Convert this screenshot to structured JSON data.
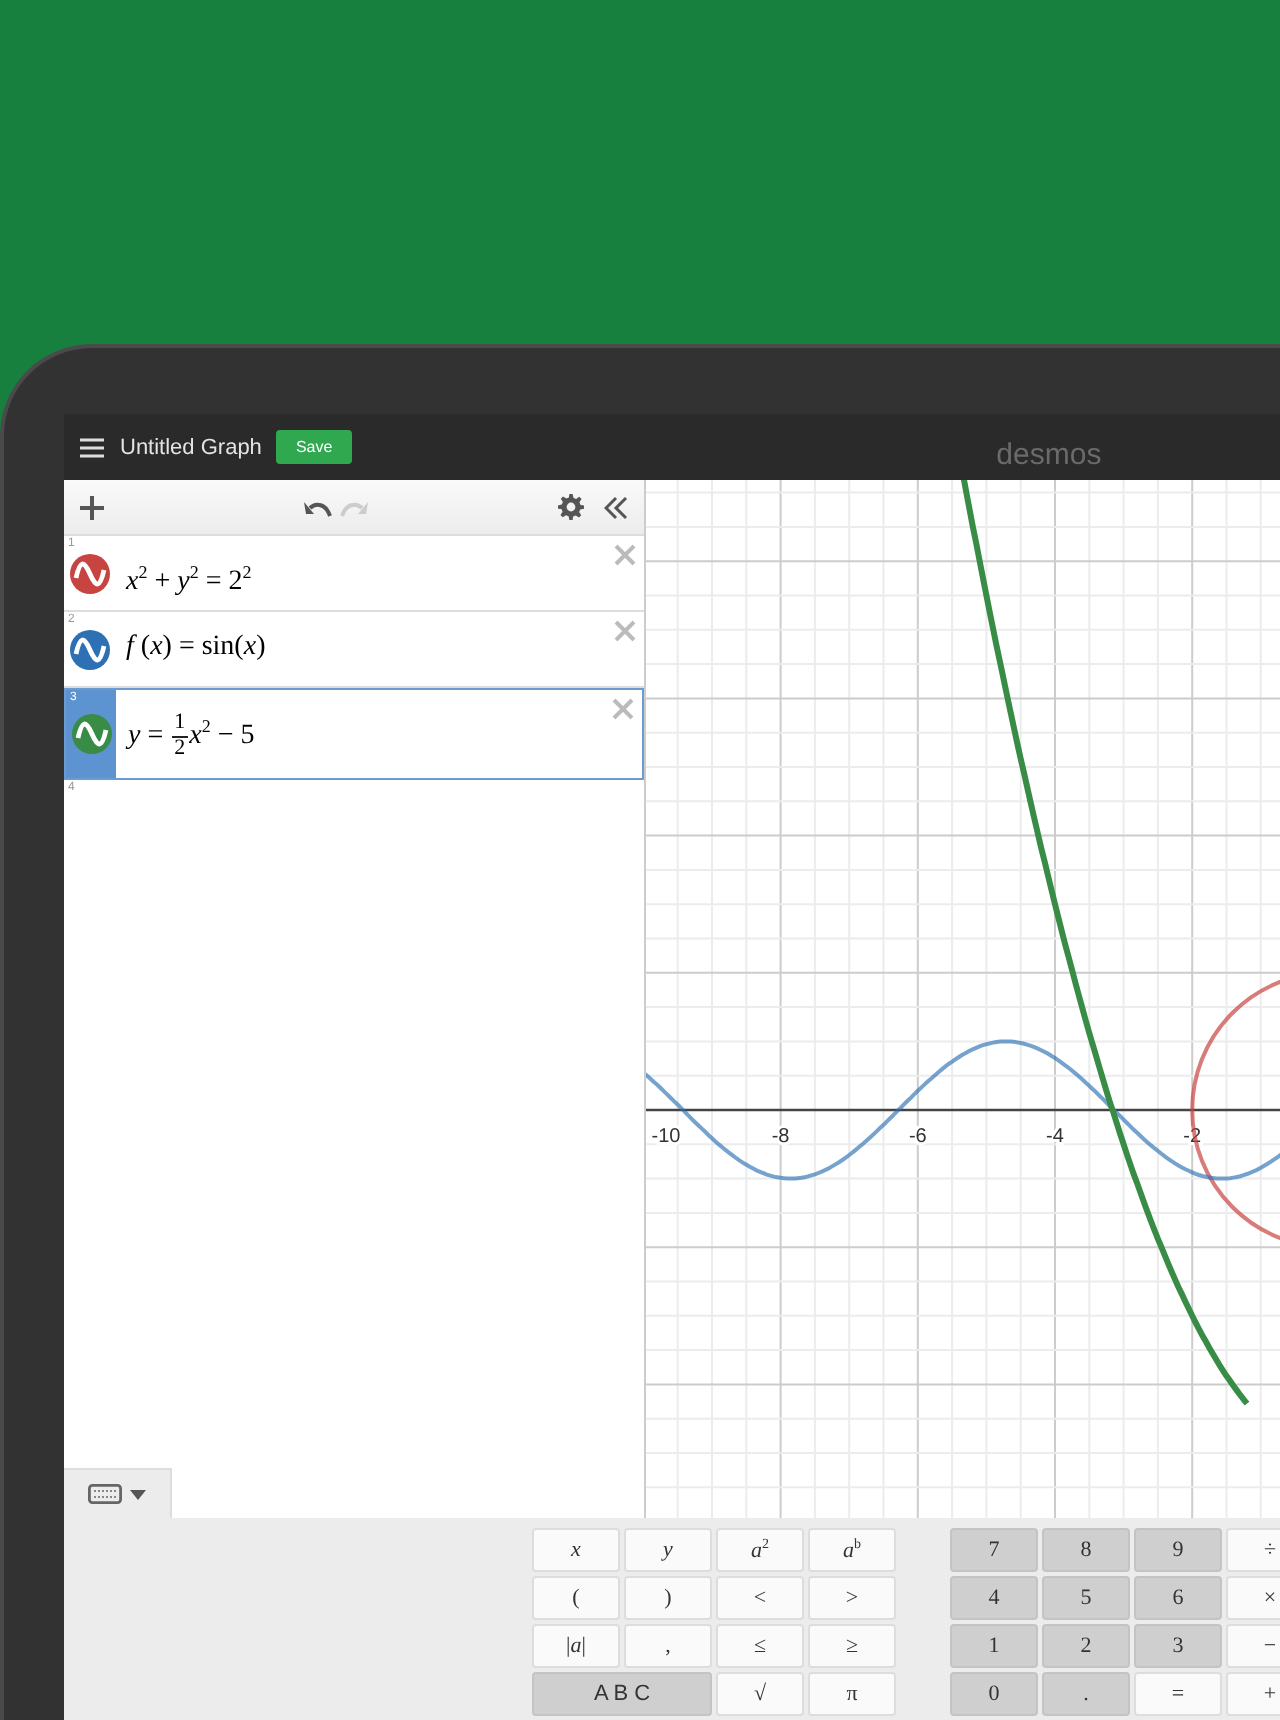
{
  "header": {
    "title": "Untitled Graph",
    "save_button": "Save",
    "logo": "desmos"
  },
  "toolbar": {
    "undo": {
      "disabled": false
    },
    "redo": {
      "disabled": true
    }
  },
  "expressions": [
    {
      "number": "1",
      "color": "#c74440",
      "selected": false,
      "kind": "plain",
      "text": "*x*$^{2}$ + *y*$^{2}$ = 2$^{2}$"
    },
    {
      "number": "2",
      "color": "#2d70b3",
      "selected": false,
      "kind": "plain",
      "text": "*f* (*x*) = sin(*x*)"
    },
    {
      "number": "3",
      "color": "#388c46",
      "selected": true,
      "kind": "fraction",
      "before": "*y* = ",
      "numerator": "1",
      "denominator": "2",
      "after": "*x*$^{2}$ − 5"
    }
  ],
  "empty_row": {
    "number": "4"
  },
  "graph": {
    "x_tick_labels": [
      "-10",
      "-8",
      "-6",
      "-4",
      "-2"
    ]
  },
  "keypad": {
    "left": [
      {
        "label": "*x*",
        "kind": "light"
      },
      {
        "label": "*y*",
        "kind": "light"
      },
      {
        "label": "*a*$^{2}$",
        "kind": "light"
      },
      {
        "label": "*a*$^{b}$",
        "kind": "light"
      },
      {
        "label": "(",
        "kind": "light"
      },
      {
        "label": ")",
        "kind": "light"
      },
      {
        "label": "<",
        "kind": "light"
      },
      {
        "label": ">",
        "kind": "light"
      },
      {
        "label": "|*a*|",
        "kind": "light"
      },
      {
        "label": ",",
        "kind": "light"
      },
      {
        "label": "≤",
        "kind": "light"
      },
      {
        "label": "≥",
        "kind": "light"
      },
      {
        "label": "A B C",
        "kind": "wide"
      },
      {
        "label": "√",
        "kind": "light"
      },
      {
        "label": "π",
        "kind": "light"
      }
    ],
    "right": [
      {
        "label": "7",
        "kind": "dark"
      },
      {
        "label": "8",
        "kind": "dark"
      },
      {
        "label": "9",
        "kind": "dark"
      },
      {
        "label": "÷",
        "kind": "light"
      },
      {
        "label": "4",
        "kind": "dark"
      },
      {
        "label": "5",
        "kind": "dark"
      },
      {
        "label": "6",
        "kind": "dark"
      },
      {
        "label": "×",
        "kind": "light"
      },
      {
        "label": "1",
        "kind": "dark"
      },
      {
        "label": "2",
        "kind": "dark"
      },
      {
        "label": "3",
        "kind": "dark"
      },
      {
        "label": "−",
        "kind": "light"
      },
      {
        "label": "0",
        "kind": "dark"
      },
      {
        "label": ".",
        "kind": "dark"
      },
      {
        "label": "=",
        "kind": "light"
      },
      {
        "label": "+",
        "kind": "light"
      }
    ]
  }
}
